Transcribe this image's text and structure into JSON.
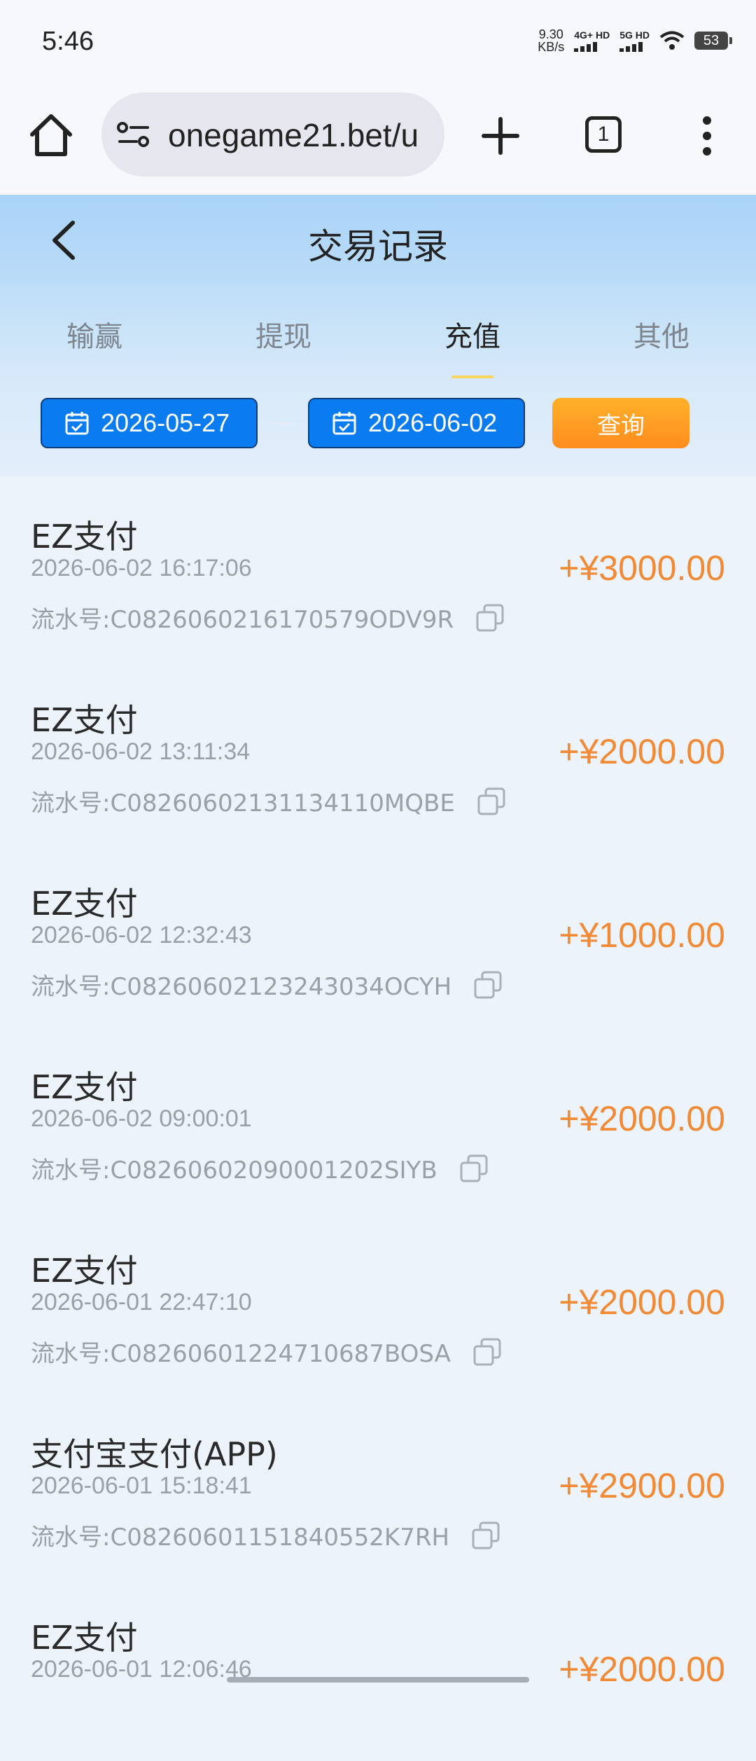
{
  "status_bar": {
    "time": "5:46",
    "net_speed_value": "9.30",
    "net_speed_unit": "KB/s",
    "signal1_label": "4G+ HD",
    "signal2_label": "5G HD",
    "battery": "53"
  },
  "browser": {
    "url": "onegame21.bet/u",
    "tab_count": "1"
  },
  "header": {
    "title": "交易记录"
  },
  "tabs": [
    {
      "label": "输赢"
    },
    {
      "label": "提现"
    },
    {
      "label": "充值"
    },
    {
      "label": "其他"
    }
  ],
  "active_tab": "充值",
  "filter": {
    "start_date": "2026-05-27",
    "end_date": "2026-06-02",
    "query_label": "查询"
  },
  "records": [
    {
      "title": "EZ支付",
      "time": "2026-06-02 16:17:06",
      "serial": "流水号:C0826060216170579ODV9R",
      "amount": "+¥3000.00"
    },
    {
      "title": "EZ支付",
      "time": "2026-06-02 13:11:34",
      "serial": "流水号:C08260602131134110MQBE",
      "amount": "+¥2000.00"
    },
    {
      "title": "EZ支付",
      "time": "2026-06-02 12:32:43",
      "serial": "流水号:C08260602123243034OCYH",
      "amount": "+¥1000.00"
    },
    {
      "title": "EZ支付",
      "time": "2026-06-02 09:00:01",
      "serial": "流水号:C08260602090001202SIYB",
      "amount": "+¥2000.00"
    },
    {
      "title": "EZ支付",
      "time": "2026-06-01 22:47:10",
      "serial": "流水号:C08260601224710687BOSA",
      "amount": "+¥2000.00"
    },
    {
      "title": "支付宝支付(APP)",
      "time": "2026-06-01 15:18:41",
      "serial": "流水号:C08260601151840552K7RH",
      "amount": "+¥2900.00"
    },
    {
      "title": "EZ支付",
      "time": "2026-06-01 12:06:46",
      "serial": "",
      "amount": "+¥2000.00"
    }
  ],
  "colors": {
    "amount": "#f28a35",
    "date_button": "#0a7cf0",
    "query_button": "#ff9a22",
    "tab_indicator": "#f7d45b"
  }
}
